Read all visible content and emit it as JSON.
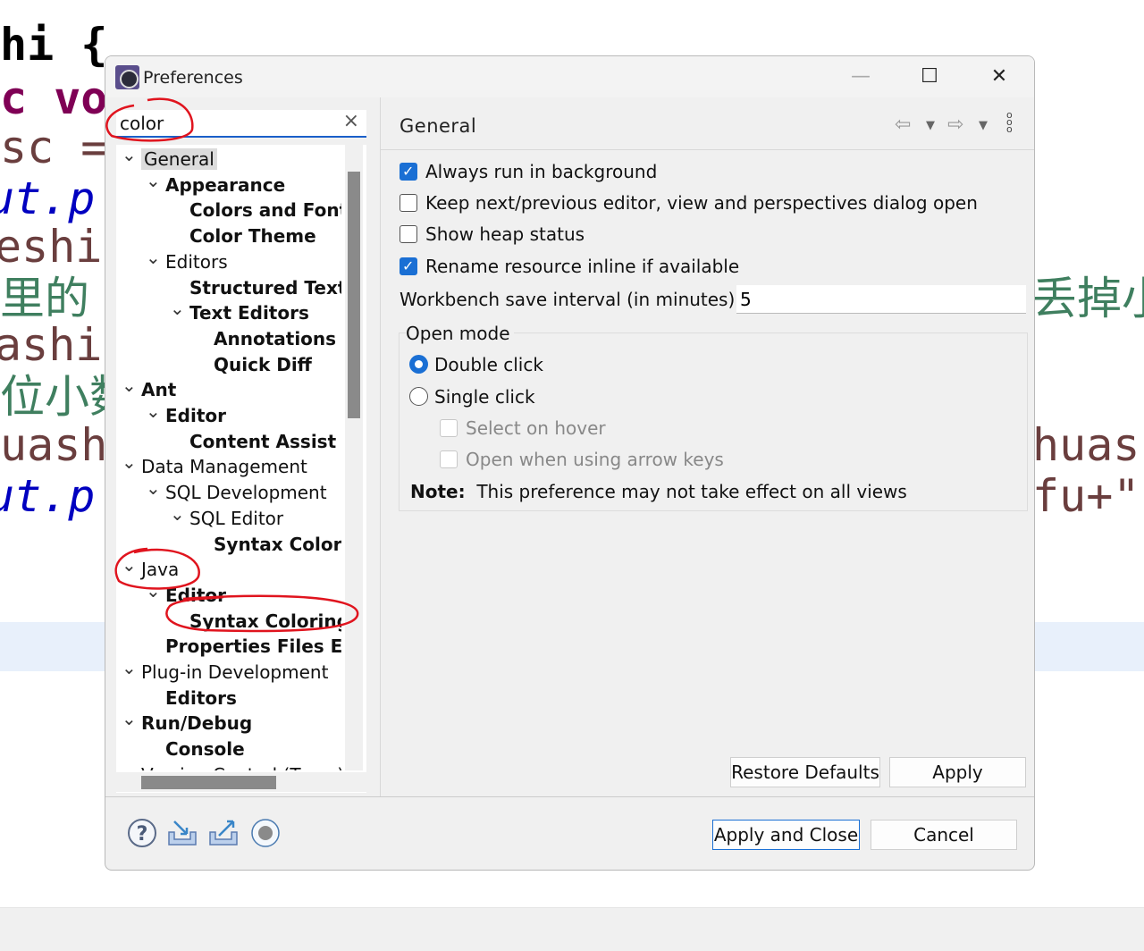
{
  "background_editor": {
    "left_lines": [
      {
        "text": "hi {",
        "color": "#000000"
      },
      {
        "text": "c vo",
        "color": "#7f0055"
      },
      {
        "text": "sc =",
        "color": "#6a3e3e"
      },
      {
        "text": "ut.p",
        "color": "#0000c0"
      },
      {
        "text": "eshi",
        "color": "#6a3e3e"
      },
      {
        "text": "里的 (",
        "color": "#3f7f5f"
      },
      {
        "text": "ashi",
        "color": "#6a3e3e"
      },
      {
        "text": "位小数",
        "color": "#3f7f5f"
      },
      {
        "text": "uash",
        "color": "#6a3e3e"
      },
      {
        "text": "ut.p",
        "color": "#0000c0"
      }
    ],
    "right_lines": [
      {
        "text": "丢掉小",
        "color": "#3f7f5f"
      },
      {
        "text": "huas",
        "color": "#6a3e3e"
      },
      {
        "text": "fu+\"",
        "color": "#6a3e3e"
      }
    ]
  },
  "dialog": {
    "title": "Preferences",
    "window_controls": {
      "minimize": "—",
      "maximize": "☐",
      "close": "✕"
    },
    "search": {
      "value": "color",
      "clear_icon": "×"
    },
    "tree": [
      {
        "label": "General",
        "level": 0,
        "expanded": true,
        "bold": false,
        "selected": true
      },
      {
        "label": "Appearance",
        "level": 1,
        "expanded": true,
        "bold": true
      },
      {
        "label": "Colors and Fonts",
        "level": 2,
        "bold": true
      },
      {
        "label": "Color Theme",
        "level": 2,
        "bold": true
      },
      {
        "label": "Editors",
        "level": 1,
        "expanded": true,
        "bold": false
      },
      {
        "label": "Structured Text",
        "level": 2,
        "bold": true
      },
      {
        "label": "Text Editors",
        "level": 2,
        "expanded": true,
        "bold": true
      },
      {
        "label": "Annotations",
        "level": 3,
        "bold": true
      },
      {
        "label": "Quick Diff",
        "level": 3,
        "bold": true
      },
      {
        "label": "Ant",
        "level": 0,
        "expanded": true,
        "bold": true
      },
      {
        "label": "Editor",
        "level": 1,
        "expanded": true,
        "bold": true
      },
      {
        "label": "Content Assist",
        "level": 2,
        "bold": true
      },
      {
        "label": "Data Management",
        "level": 0,
        "expanded": true,
        "bold": false
      },
      {
        "label": "SQL Development",
        "level": 1,
        "expanded": true,
        "bold": false
      },
      {
        "label": "SQL Editor",
        "level": 2,
        "expanded": true,
        "bold": false
      },
      {
        "label": "Syntax Coloring",
        "level": 3,
        "bold": true
      },
      {
        "label": "Java",
        "level": 0,
        "expanded": true,
        "bold": false
      },
      {
        "label": "Editor",
        "level": 1,
        "expanded": true,
        "bold": true
      },
      {
        "label": "Syntax Coloring",
        "level": 2,
        "bold": true
      },
      {
        "label": "Properties Files Editor",
        "level": 1,
        "bold": true
      },
      {
        "label": "Plug-in Development",
        "level": 0,
        "expanded": true,
        "bold": false
      },
      {
        "label": "Editors",
        "level": 1,
        "bold": true
      },
      {
        "label": "Run/Debug",
        "level": 0,
        "expanded": true,
        "bold": true
      },
      {
        "label": "Console",
        "level": 1,
        "bold": true
      },
      {
        "label": "Version Control (Team)",
        "level": 0,
        "bold": false
      }
    ],
    "page": {
      "title": "General",
      "checkboxes": [
        {
          "label": "Always run in background",
          "checked": true
        },
        {
          "label": "Keep next/previous editor, view and perspectives dialog open",
          "checked": false
        },
        {
          "label": "Show heap status",
          "checked": false
        },
        {
          "label": "Rename resource inline if available",
          "checked": true
        }
      ],
      "save_interval_label": "Workbench save interval (in minutes):",
      "save_interval_value": "5",
      "open_mode": {
        "title": "Open mode",
        "options": [
          {
            "label": "Double click",
            "selected": true
          },
          {
            "label": "Single click",
            "selected": false
          }
        ],
        "sub_options": [
          {
            "label": "Select on hover",
            "checked": false,
            "enabled": false
          },
          {
            "label": "Open when using arrow keys",
            "checked": false,
            "enabled": false
          }
        ],
        "note_label": "Note:",
        "note_text": "This preference may not take effect on all views"
      },
      "restore_defaults": "Restore Defaults",
      "apply": "Apply"
    },
    "footer": {
      "apply_and_close": "Apply and Close",
      "cancel": "Cancel"
    },
    "colors": {
      "accent": "#1a6fd4",
      "annotation": "#e0141e"
    }
  }
}
